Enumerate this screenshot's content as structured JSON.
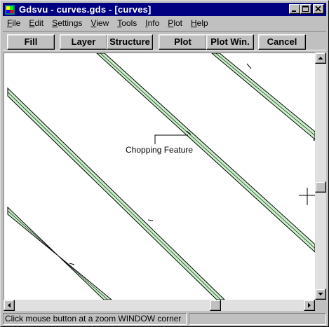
{
  "window": {
    "title": "Gdsvu - curves.gds - [curves]"
  },
  "menu": [
    {
      "label": "File",
      "mnemonic": "F",
      "rest": "ile"
    },
    {
      "label": "Edit",
      "mnemonic": "E",
      "rest": "dit"
    },
    {
      "label": "Settings",
      "mnemonic": "S",
      "rest": "ettings"
    },
    {
      "label": "View",
      "mnemonic": "V",
      "rest": "iew"
    },
    {
      "label": "Tools",
      "mnemonic": "T",
      "rest": "ools"
    },
    {
      "label": "Info",
      "mnemonic": "I",
      "rest": "nfo"
    },
    {
      "label": "Plot",
      "mnemonic": "P",
      "rest": "lot"
    },
    {
      "label": "Help",
      "mnemonic": "H",
      "rest": "elp"
    }
  ],
  "toolbar": {
    "fill": "Fill",
    "layer": "Layer",
    "structure": "Structure",
    "plot": "Plot",
    "plot_win": "Plot Win.",
    "cancel": "Cancel"
  },
  "canvas": {
    "annotation": "Chopping Feature",
    "path_fill_color": "#c8f0c8",
    "path_stroke_color": "#000000"
  },
  "status": {
    "message": "Click mouse button at a zoom WINDOW corner"
  },
  "icons": {
    "app": "gdsvu-app-icon",
    "minimize": "minimize-icon",
    "maximize": "maximize-icon",
    "close": "close-icon",
    "crosshair": "crosshair-cursor-icon"
  }
}
